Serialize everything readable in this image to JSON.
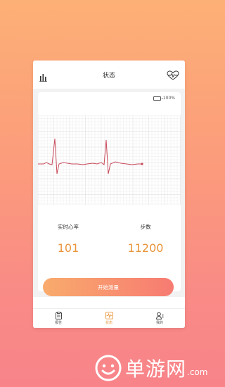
{
  "header": {
    "title": "状态"
  },
  "device": {
    "battery_percent": "100%",
    "battery_level": 1.0
  },
  "stats": {
    "heart_rate_label": "实时心率",
    "heart_rate_value": "101",
    "steps_label": "步数",
    "steps_value": "11200"
  },
  "actions": {
    "start_label": "开始测量"
  },
  "tabs": [
    {
      "label": "报告",
      "icon": "clipboard-icon",
      "active": false
    },
    {
      "label": "状态",
      "icon": "ecg-icon",
      "active": true
    },
    {
      "label": "我的",
      "icon": "user-icon",
      "active": false
    }
  ],
  "watermark": {
    "text": "单游网",
    "suffix": ".com"
  },
  "colors": {
    "accent": "#e9953a",
    "ecg_line": "#c84a5a",
    "button_start": "#f9ab6c",
    "button_end": "#f77b72",
    "battery": "#3fc13f"
  }
}
